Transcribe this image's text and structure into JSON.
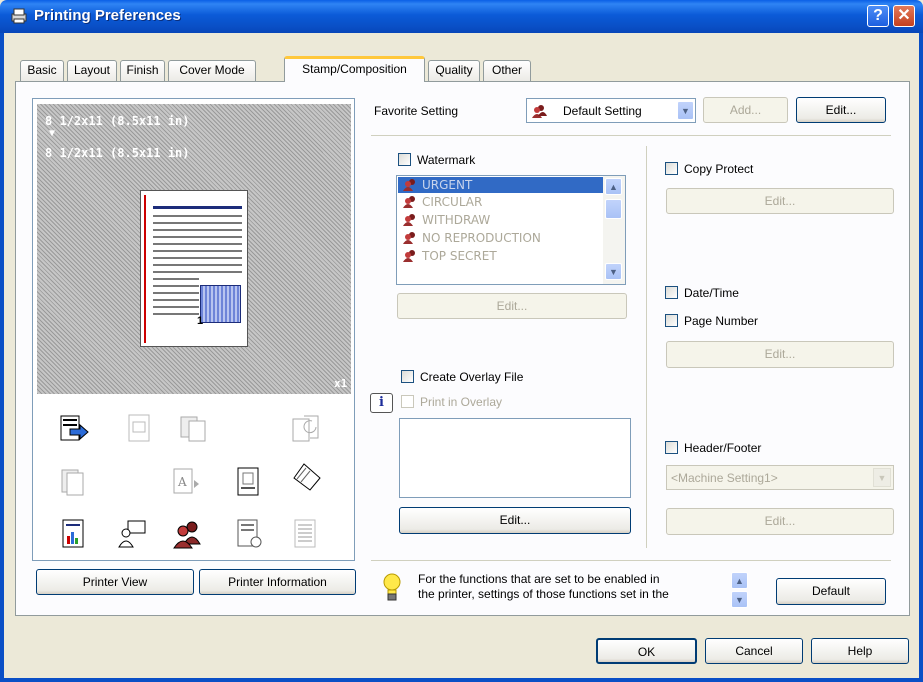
{
  "window": {
    "title": "Printing Preferences",
    "help_glyph": "?",
    "close_glyph": "✕"
  },
  "tabs": [
    {
      "label": "Basic"
    },
    {
      "label": "Layout"
    },
    {
      "label": "Finish"
    },
    {
      "label": "Cover Mode"
    },
    {
      "label": "Stamp/Composition"
    },
    {
      "label": "Quality"
    },
    {
      "label": "Other"
    }
  ],
  "active_tab": "Stamp/Composition",
  "preview": {
    "original_size": "8 1/2x11 (8.5x11 in)",
    "arrow": "▼",
    "output_size": "8 1/2x11 (8.5x11 in)",
    "copies": "x1",
    "page_number": "1"
  },
  "left_buttons": {
    "printer_view": "Printer View",
    "printer_information": "Printer Information"
  },
  "favorite": {
    "label": "Favorite Setting",
    "value": "Default Setting",
    "add": "Add...",
    "edit": "Edit..."
  },
  "watermark": {
    "label": "Watermark",
    "checked": false,
    "items": [
      "URGENT",
      "CIRCULAR",
      "WITHDRAW",
      "NO REPRODUCTION",
      "TOP SECRET"
    ],
    "selected_index": 0,
    "edit": "Edit..."
  },
  "overlay": {
    "create_label": "Create Overlay File",
    "print_label": "Print in Overlay",
    "edit": "Edit..."
  },
  "copy_protect": {
    "label": "Copy Protect",
    "edit": "Edit..."
  },
  "date_time": {
    "label": "Date/Time"
  },
  "page_number": {
    "label": "Page Number",
    "edit": "Edit..."
  },
  "header_footer": {
    "label": "Header/Footer",
    "value": "<Machine Setting1>",
    "edit": "Edit..."
  },
  "info": {
    "line1": "For the functions that are set to be enabled in",
    "line2": "the printer, settings of those functions set in the",
    "default": "Default"
  },
  "footer": {
    "ok": "OK",
    "cancel": "Cancel",
    "help": "Help"
  },
  "colors": {
    "titlebar": "#0A4FC6",
    "selection": "#316AC5",
    "tab_highlight": "#FFC83C"
  }
}
